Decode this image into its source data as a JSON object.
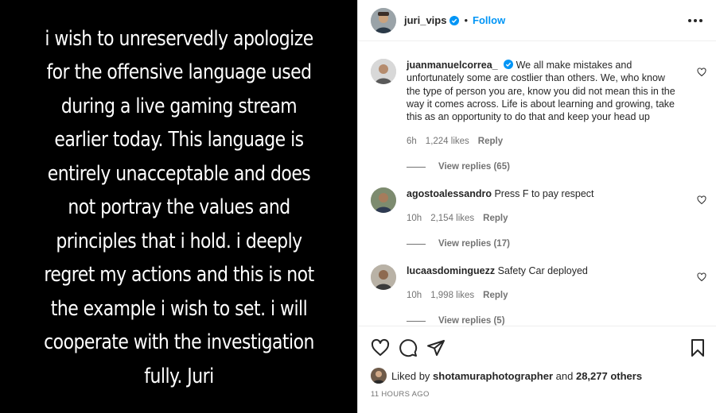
{
  "post": {
    "text": "i wish to unreservedly apologize for the offensive language used during a live gaming stream earlier today. This language is entirely unacceptable and does not portray the values and principles that i hold. i deeply regret my actions and this is not the example i wish to set. i will cooperate with the investigation fully. Juri"
  },
  "header": {
    "username": "juri_vips",
    "separator": "•",
    "follow_label": "Follow",
    "verified_icon": "verified-badge-icon",
    "more_icon": "more-options-icon"
  },
  "comments": [
    {
      "username": "juanmanuelcorrea_",
      "verified": true,
      "text": "We all make mistakes and unfortunately some are costlier than others. We, who know the type of person you are, know you did not mean this in the way it comes across. Life is about learning and growing, take this as an opportunity to do that and keep your head up",
      "time": "6h",
      "likes": "1,224 likes",
      "reply": "Reply",
      "view_replies": "View replies (65)"
    },
    {
      "username": "agostoalessandro",
      "verified": false,
      "text": "Press F to pay respect",
      "time": "10h",
      "likes": "2,154 likes",
      "reply": "Reply",
      "view_replies": "View replies (17)"
    },
    {
      "username": "lucaasdominguezz",
      "verified": false,
      "text": "Safety Car deployed",
      "time": "10h",
      "likes": "1,998 likes",
      "reply": "Reply",
      "view_replies": "View replies (5)"
    }
  ],
  "actions": {
    "icons": [
      "heart-icon",
      "comment-icon",
      "share-icon",
      "bookmark-icon"
    ],
    "liked_prefix": "Liked by",
    "liked_user": "shotamuraphotographer",
    "liked_and": "and",
    "liked_others": "28,277 others",
    "time_ago": "11 HOURS AGO"
  },
  "colors": {
    "accent": "#0095f6",
    "text": "#262626",
    "muted": "#737373"
  }
}
